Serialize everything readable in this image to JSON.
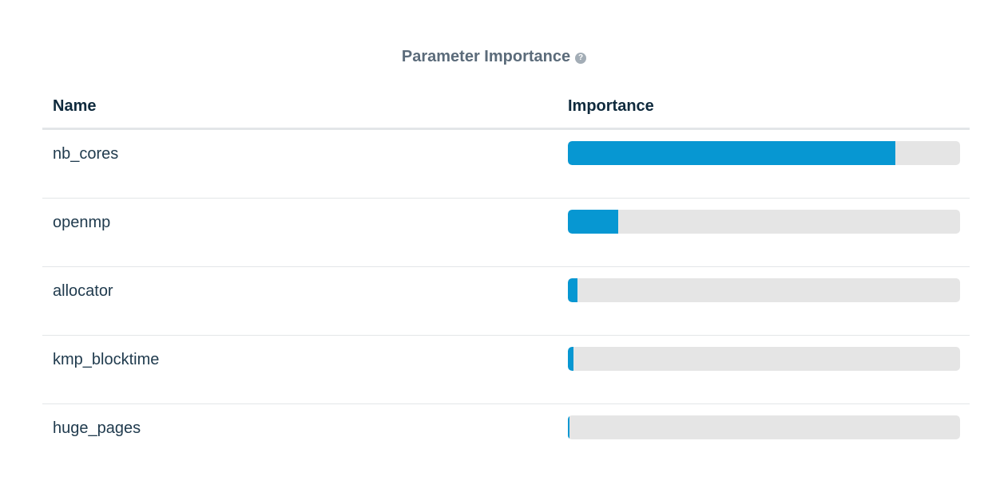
{
  "title": "Parameter Importance",
  "help_icon": "question-circle-icon",
  "columns": {
    "name": "Name",
    "importance": "Importance"
  },
  "accent_color": "#0797d2",
  "track_color": "#e5e5e5",
  "rows": [
    {
      "name": "nb_cores",
      "importance": 0.835
    },
    {
      "name": "openmp",
      "importance": 0.128
    },
    {
      "name": "allocator",
      "importance": 0.024
    },
    {
      "name": "kmp_blocktime",
      "importance": 0.014
    },
    {
      "name": "huge_pages",
      "importance": 0.004
    }
  ]
}
